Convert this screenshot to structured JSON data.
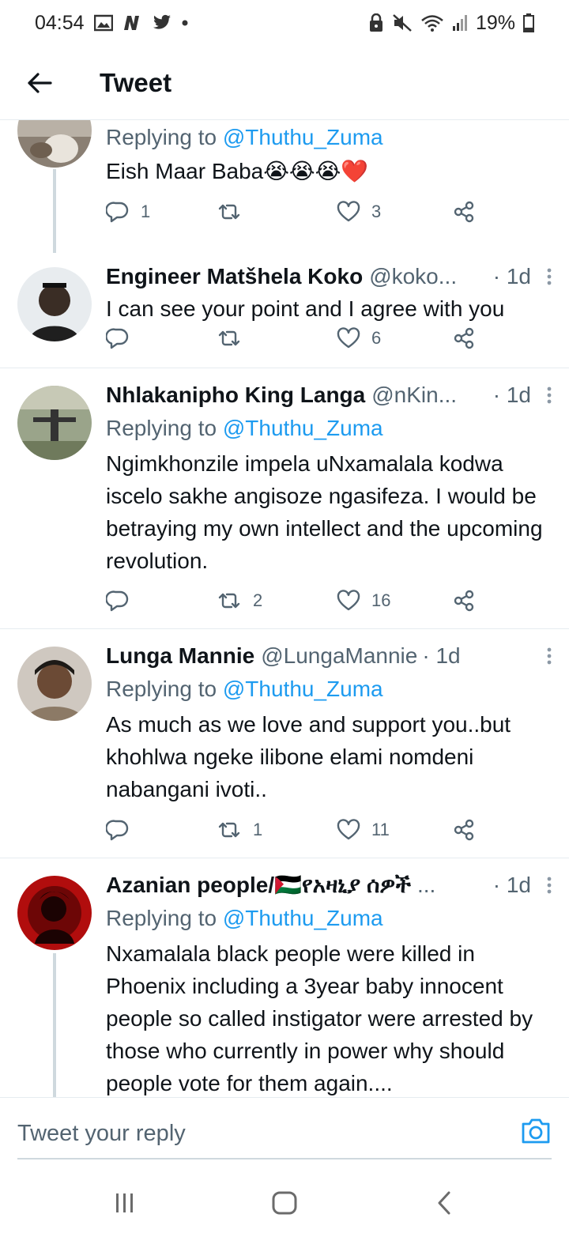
{
  "status": {
    "time": "04:54",
    "battery": "19%"
  },
  "header": {
    "title": "Tweet"
  },
  "tweets": [
    {
      "reply_prefix": "Replying to",
      "reply_to": "@Thuthu_Zuma",
      "text": "Eish Maar Baba😭😭😭❤️",
      "replies": "1",
      "retweets": "",
      "likes": "3"
    },
    {
      "name": "Engineer Matšhela Koko",
      "handle": "@koko...",
      "time": "· 1d",
      "text": "I can see your point and I agree with you",
      "replies": "",
      "retweets": "",
      "likes": "6"
    },
    {
      "name": "Nhlakanipho King Langa",
      "handle": "@nKin...",
      "time": "· 1d",
      "reply_prefix": "Replying to",
      "reply_to": "@Thuthu_Zuma",
      "text": "Ngimkhonzile impela uNxamalala kodwa iscelo sakhe angisoze ngasifeza. I would be betraying my own intellect and the upcoming revolution.",
      "replies": "",
      "retweets": "2",
      "likes": "16"
    },
    {
      "name": "Lunga Mannie",
      "handle": "@LungaMannie",
      "time": "· 1d",
      "reply_prefix": "Replying to",
      "reply_to": "@Thuthu_Zuma",
      "text": "As much as we love and support you..but khohlwa ngeke ilibone elami nomdeni nabangani ivoti..",
      "replies": "",
      "retweets": "1",
      "likes": "11"
    },
    {
      "name": "Azanian people/🇵🇸የአዛኒያ ሰዎች",
      "handle": "...",
      "time": "· 1d",
      "reply_prefix": "Replying to",
      "reply_to": "@Thuthu_Zuma",
      "text": "Nxamalala black people were killed in Phoenix including a 3year baby innocent people so called instigator were arrested by those who currently in power why should people vote for them again...."
    }
  ],
  "reply_bar": {
    "placeholder": "Tweet your reply"
  },
  "colors": {
    "accent": "#1d9bf0",
    "secondary_text": "#536471",
    "divider": "#e6ecf0"
  },
  "icons": {
    "back": "arrow-left-icon",
    "more": "more-vertical-icon",
    "reply": "comment-bubble-icon",
    "retweet": "retweet-icon",
    "like": "heart-icon",
    "share": "share-icon",
    "camera": "camera-icon"
  }
}
